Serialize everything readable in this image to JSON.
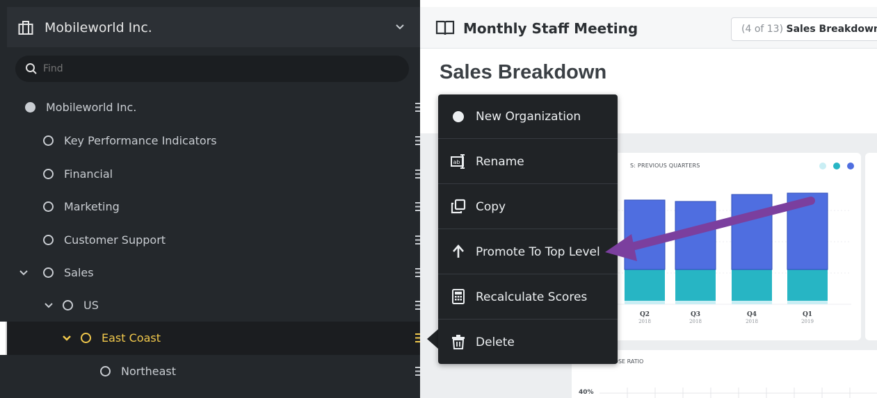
{
  "sidebar": {
    "org_name": "Mobileworld Inc.",
    "search_placeholder": "Find",
    "tree": [
      {
        "label": "Mobileworld Inc."
      },
      {
        "label": "Key Performance Indicators"
      },
      {
        "label": "Financial"
      },
      {
        "label": "Marketing"
      },
      {
        "label": "Customer Support"
      },
      {
        "label": "Sales"
      },
      {
        "label": "US"
      },
      {
        "label": "East Coast"
      },
      {
        "label": "Northeast"
      }
    ]
  },
  "topbar": {
    "meeting_title": "Monthly Staff Meeting",
    "slide_count": "(4 of 13)",
    "slide_name": "Sales Breakdown"
  },
  "page": {
    "title": "Sales Breakdown"
  },
  "chart": {
    "title_fragment": "S: PREVIOUS QUARTERS",
    "legend_colors": [
      "#c9eef4",
      "#27b5c4",
      "#4f6ee0"
    ]
  },
  "close_ratio": {
    "title": "MONTHLY CLOSE RATIO",
    "tick": "40%"
  },
  "context_menu": {
    "items": [
      {
        "label": "New Organization",
        "icon": "circle-icon"
      },
      {
        "label": "Rename",
        "icon": "rename-icon"
      },
      {
        "label": "Copy",
        "icon": "copy-icon"
      },
      {
        "label": "Promote To Top Level",
        "icon": "arrow-up-icon"
      },
      {
        "label": "Recalculate Scores",
        "icon": "calculator-icon"
      },
      {
        "label": "Delete",
        "icon": "trash-icon"
      }
    ]
  },
  "chart_data": {
    "type": "bar",
    "title": "S: PREVIOUS QUARTERS",
    "categories": [
      "Q2 2018",
      "Q3 2018",
      "Q4 2018",
      "Q1 2019"
    ],
    "category_labels": [
      [
        "Q2",
        "2018"
      ],
      [
        "Q3",
        "2018"
      ],
      [
        "Q4",
        "2018"
      ],
      [
        "Q1",
        "2019"
      ]
    ],
    "series": [
      {
        "color": "#c9eef4",
        "values": [
          5,
          5,
          5,
          5
        ]
      },
      {
        "color": "#27b5c4",
        "values": [
          45,
          45,
          45,
          45
        ]
      },
      {
        "color": "#4f6ee0",
        "values": [
          100,
          98,
          108,
          110
        ]
      }
    ]
  }
}
